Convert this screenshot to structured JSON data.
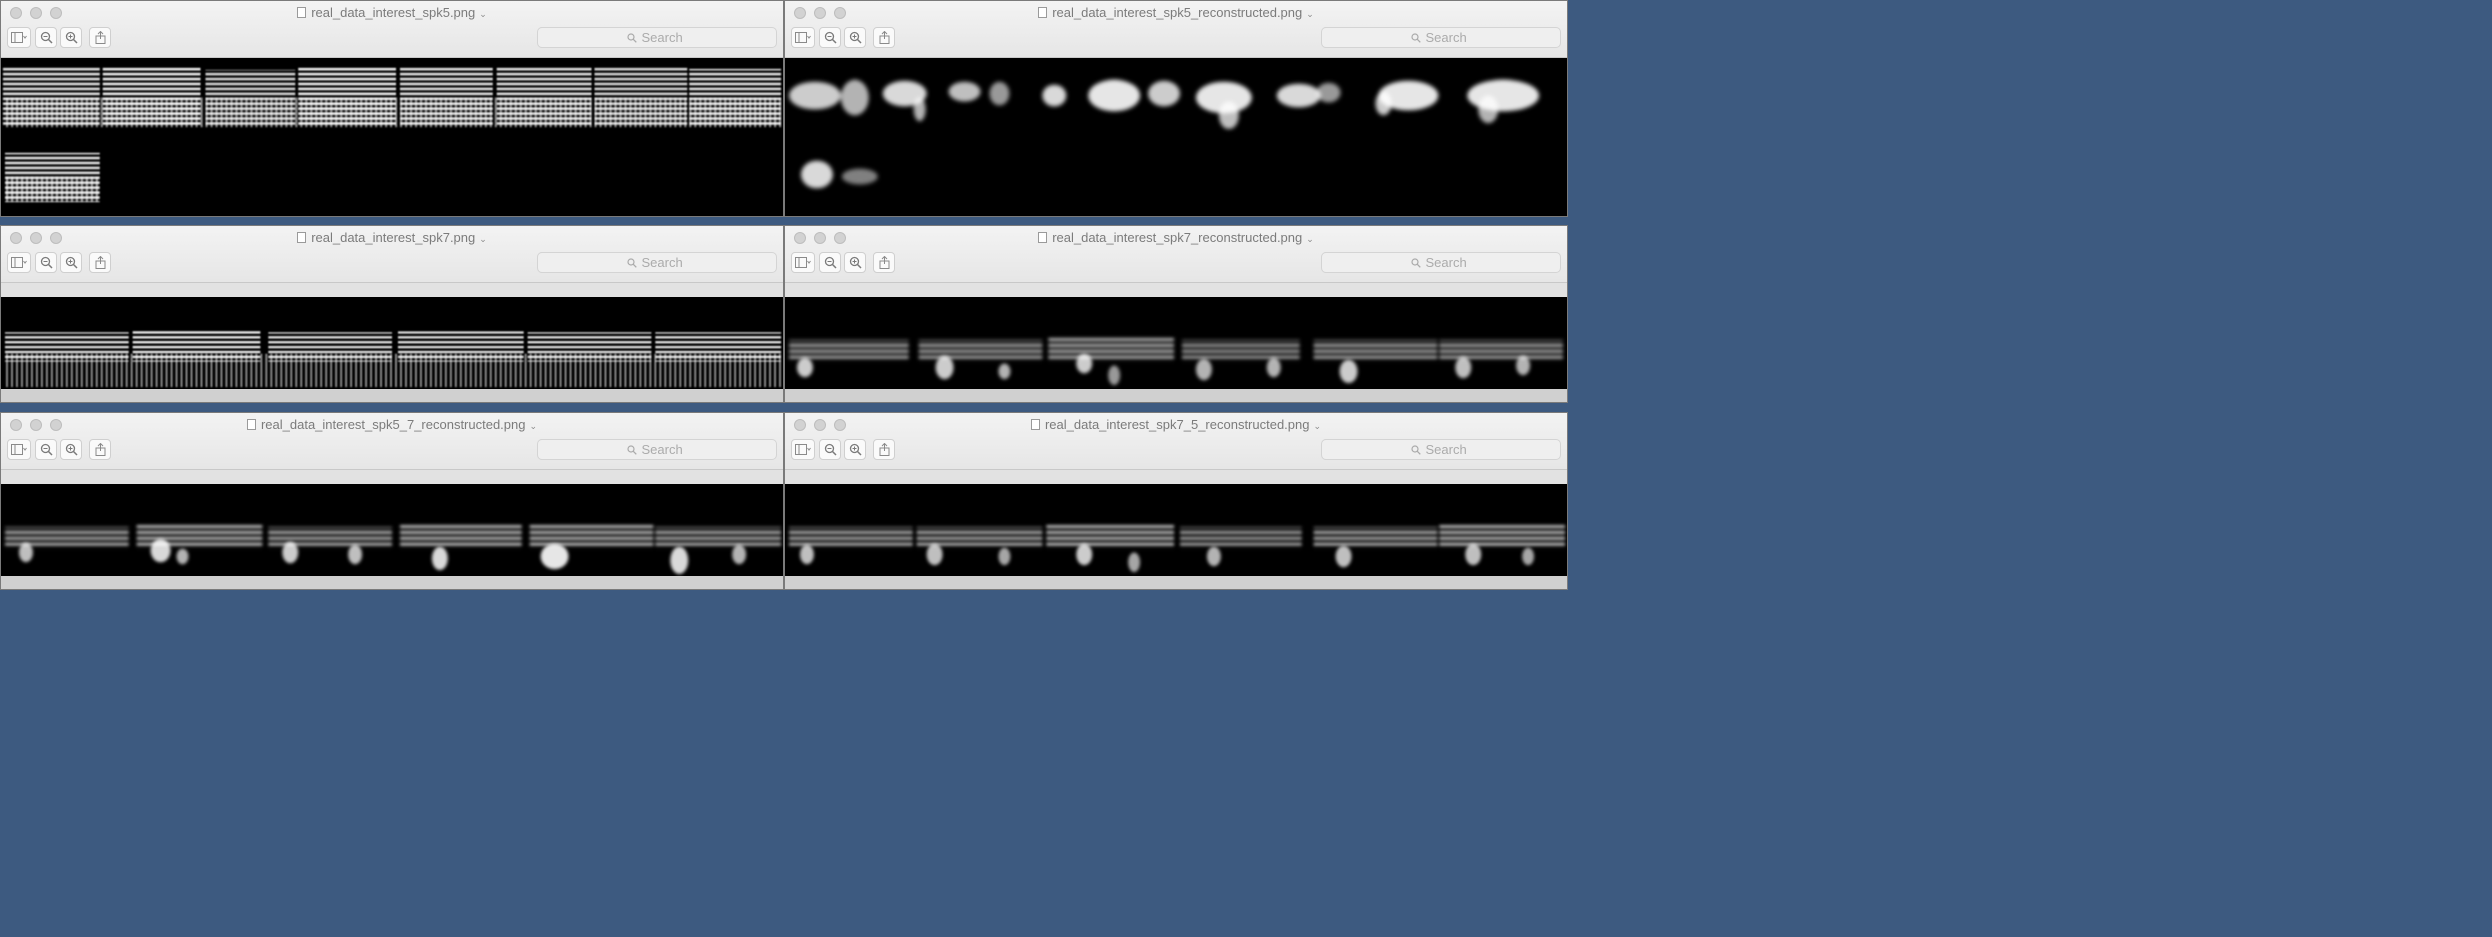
{
  "windows": [
    {
      "title": "real_data_interest_spk5.png",
      "search_placeholder": "Search"
    },
    {
      "title": "real_data_interest_spk5_reconstructed.png",
      "search_placeholder": "Search"
    },
    {
      "title": "real_data_interest_spk7.png",
      "search_placeholder": "Search"
    },
    {
      "title": "real_data_interest_spk7_reconstructed.png",
      "search_placeholder": "Search"
    },
    {
      "title": "real_data_interest_spk5_7_reconstructed.png",
      "search_placeholder": "Search"
    },
    {
      "title": "real_data_interest_spk7_5_reconstructed.png",
      "search_placeholder": "Search"
    }
  ],
  "icons": {
    "sidebar": "sidebar-toggle-icon",
    "zoom_out": "zoom-out-icon",
    "zoom_in": "zoom-in-icon",
    "share": "share-icon",
    "markup": "markup-pen-icon",
    "rotate": "rotate-icon",
    "toolbox": "toolbox-icon",
    "search": "search-icon"
  },
  "colors": {
    "desktop": "#3d5a80",
    "titlebar": "#ececec",
    "image_bg": "#000000",
    "spectrogram": "#ffffff"
  }
}
